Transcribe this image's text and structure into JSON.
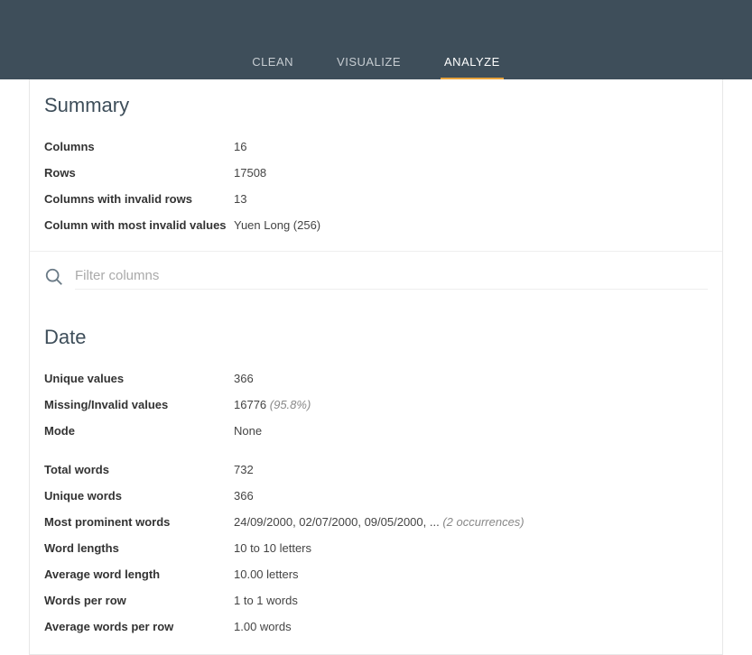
{
  "tabs": {
    "clean": "CLEAN",
    "visualize": "VISUALIZE",
    "analyze": "ANALYZE"
  },
  "summary": {
    "title": "Summary",
    "labels": {
      "columns": "Columns",
      "rows": "Rows",
      "cols_invalid": "Columns with invalid rows",
      "col_most_invalid": "Column with most invalid values"
    },
    "values": {
      "columns": "16",
      "rows": "17508",
      "cols_invalid": "13",
      "col_most_invalid": "Yuen Long (256)"
    }
  },
  "filter": {
    "placeholder": "Filter columns"
  },
  "date": {
    "title": "Date",
    "labels": {
      "unique_values": "Unique values",
      "missing": "Missing/Invalid values",
      "mode": "Mode",
      "total_words": "Total words",
      "unique_words": "Unique words",
      "prominent": "Most prominent words",
      "word_lengths": "Word lengths",
      "avg_word_len": "Average word length",
      "words_per_row": "Words per row",
      "avg_words_per_row": "Average words per row"
    },
    "values": {
      "unique_values": "366",
      "missing": "16776",
      "missing_pct": " (95.8%)",
      "mode": "None",
      "total_words": "732",
      "unique_words": "366",
      "prominent": "24/09/2000, 02/07/2000, 09/05/2000, ...",
      "prominent_hint": " (2 occurrences)",
      "word_lengths": "10 to 10 letters",
      "avg_word_len": "10.00 letters",
      "words_per_row": "1 to 1 words",
      "avg_words_per_row": "1.00 words"
    }
  }
}
